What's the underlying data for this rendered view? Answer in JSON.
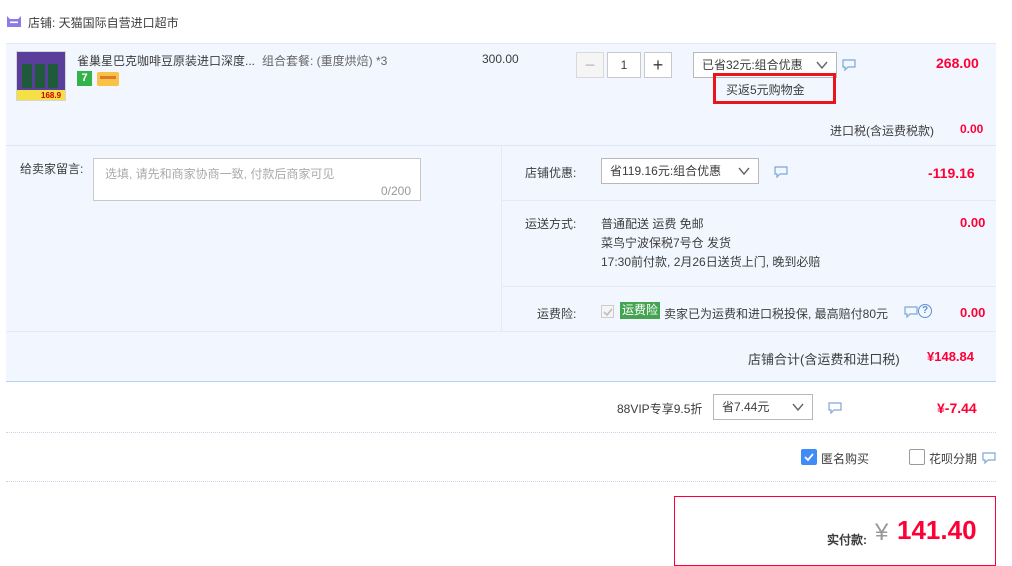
{
  "shop": {
    "label": "店铺: 天猫国际自营进口超市"
  },
  "item": {
    "title": "雀巢星巴克咖啡豆原装进口深度...",
    "sku": "组合套餐: (重度烘焙) *3",
    "thumb_price": "168.9",
    "badge_seven": "7",
    "price": "300.00",
    "quantity": "1",
    "promo_select": "已省32元:组合优惠",
    "promo_tip": "买返5元购物金",
    "subtotal": "268.00",
    "tax_label": "进口税(含运费税款)",
    "tax_value": "0.00"
  },
  "message": {
    "label": "给卖家留言:",
    "placeholder": "选填, 请先和商家协商一致, 付款后商家可见",
    "counter": "0/200"
  },
  "shop_discount": {
    "label": "店铺优惠:",
    "select": "省119.16元:组合优惠",
    "value": "-119.16"
  },
  "shipping": {
    "label": "运送方式:",
    "line1": "普通配送 运费 免邮",
    "line2": "菜鸟宁波保税7号仓   发货",
    "line3": "17:30前付款, 2月26日送货上门, 晚到必赔",
    "value": "0.00"
  },
  "insurance": {
    "label": "运费险:",
    "tag": "运费险",
    "desc": "卖家已为运费和进口税投保, 最高赔付80元",
    "value": "0.00"
  },
  "shop_total": {
    "label": "店铺合计(含运费和进口税)",
    "value": "¥148.84"
  },
  "vip": {
    "label": "88VIP专享9.5折",
    "select": "省7.44元",
    "value": "¥-7.44"
  },
  "options": {
    "anonymous": "匿名购买",
    "huabei": "花呗分期"
  },
  "pay": {
    "label": "实付款:",
    "currency": "¥",
    "amount": "141.40"
  },
  "colors": {
    "accent": "#ff0036",
    "panel": "#f2f7ff",
    "border": "#b2d1ff",
    "checkbox": "#3f8bf8",
    "tag_green": "#44a452"
  }
}
